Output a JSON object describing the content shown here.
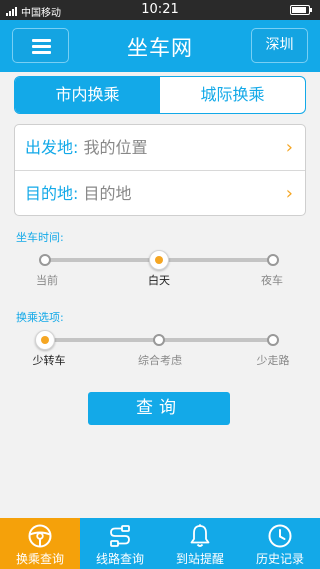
{
  "status_bar": {
    "carrier": "中国移动",
    "time": "10:21"
  },
  "header": {
    "title": "坐车网",
    "city": "深圳"
  },
  "tabs": [
    {
      "label": "市内换乘",
      "active": true
    },
    {
      "label": "城际换乘",
      "active": false
    }
  ],
  "form": {
    "origin_label": "出发地:",
    "origin_value": "我的位置",
    "destination_label": "目的地:",
    "destination_value": "目的地"
  },
  "time_option": {
    "label": "坐车时间:",
    "options": [
      "当前",
      "白天",
      "夜车"
    ],
    "selected_index": 1
  },
  "transfer_option": {
    "label": "换乘选项:",
    "options": [
      "少转车",
      "综合考虑",
      "少走路"
    ],
    "selected_index": 0
  },
  "query_button": "查询",
  "bottom_nav": [
    {
      "label": "换乘查询",
      "icon": "steering-wheel-icon",
      "active": true
    },
    {
      "label": "线路查询",
      "icon": "route-icon",
      "active": false
    },
    {
      "label": "到站提醒",
      "icon": "bell-icon",
      "active": false
    },
    {
      "label": "历史记录",
      "icon": "clock-icon",
      "active": false
    }
  ],
  "colors": {
    "primary": "#13a9e8",
    "accent": "#f5a623"
  }
}
